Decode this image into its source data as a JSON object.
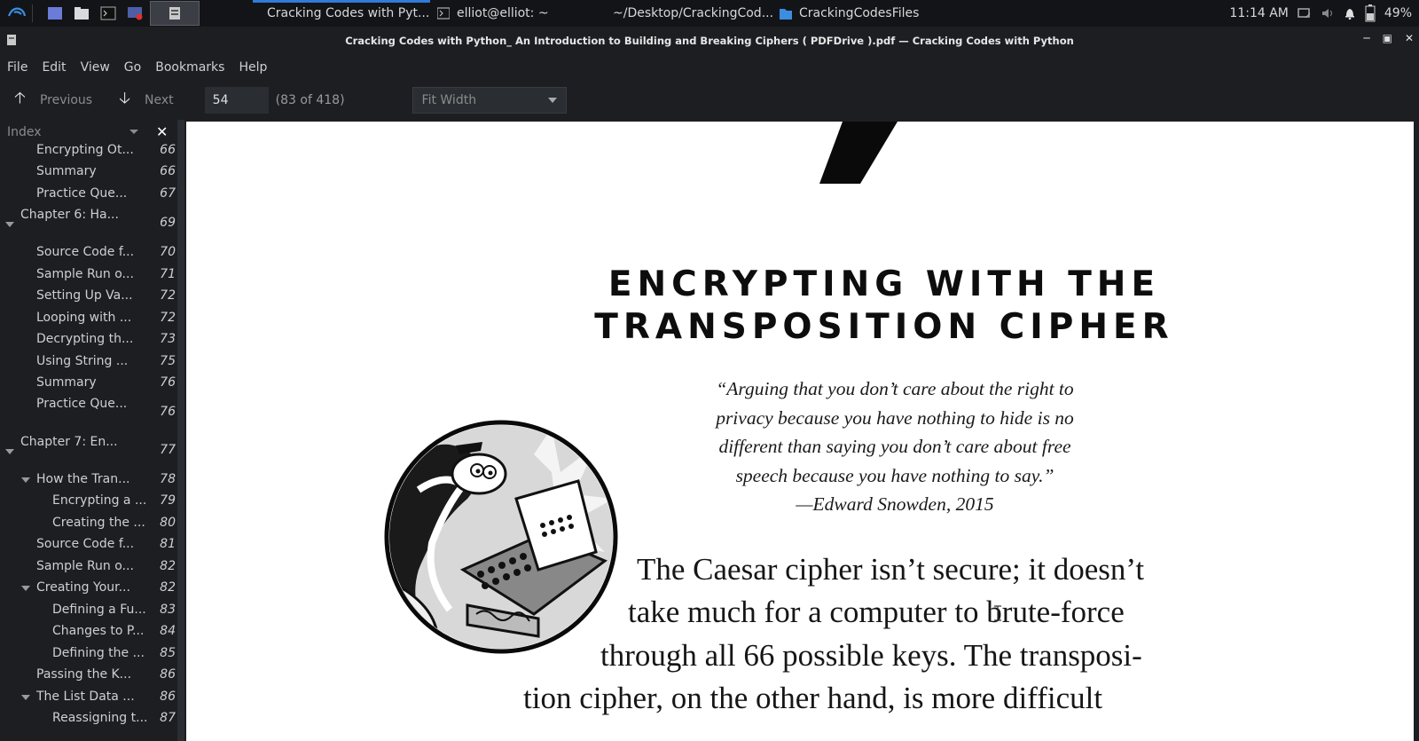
{
  "taskbar": {
    "tasks": [
      {
        "label": "Cracking Codes with Pyt..."
      },
      {
        "label": "elliot@elliot: ~"
      },
      {
        "label": "~/Desktop/CrackingCod..."
      },
      {
        "label": "CrackingCodesFiles"
      }
    ],
    "clock": "11:14 AM",
    "battery": "49%"
  },
  "window": {
    "title": "Cracking Codes with Python_ An Introduction to Building and Breaking Ciphers ( PDFDrive ).pdf — Cracking Codes with Python"
  },
  "menu": [
    "File",
    "Edit",
    "View",
    "Go",
    "Bookmarks",
    "Help"
  ],
  "toolbar": {
    "previous_label": "Previous",
    "next_label": "Next",
    "page_value": "54",
    "page_count": "(83 of 418)",
    "zoom": "Fit Width"
  },
  "sidebar": {
    "header": "Index",
    "items": [
      {
        "label": "Encrypting Ot...",
        "page": "66"
      },
      {
        "label": "Summary",
        "page": "66"
      },
      {
        "label": "Practice Que...",
        "page": "67"
      },
      {
        "label": "Chapter 6: Ha...",
        "page": "69"
      },
      {
        "label": "Source Code f...",
        "page": "70"
      },
      {
        "label": "Sample Run o...",
        "page": "71"
      },
      {
        "label": "Setting Up Va...",
        "page": "72"
      },
      {
        "label": "Looping with ...",
        "page": "72"
      },
      {
        "label": "Decrypting th...",
        "page": "73"
      },
      {
        "label": "Using String ...",
        "page": "75"
      },
      {
        "label": "Summary",
        "page": "76"
      },
      {
        "label": "Practice Que...",
        "page": "76"
      },
      {
        "label": "Chapter 7: En...",
        "page": "77"
      },
      {
        "label": "How the Tran...",
        "page": "78"
      },
      {
        "label": "Encrypting a ...",
        "page": "79"
      },
      {
        "label": "Creating the ...",
        "page": "80"
      },
      {
        "label": "Source Code f...",
        "page": "81"
      },
      {
        "label": "Sample Run o...",
        "page": "82"
      },
      {
        "label": "Creating Your...",
        "page": "82"
      },
      {
        "label": "Defining a Fu...",
        "page": "83"
      },
      {
        "label": "Changes to P...",
        "page": "84"
      },
      {
        "label": "Defining the ...",
        "page": "85"
      },
      {
        "label": "Passing the K...",
        "page": "86"
      },
      {
        "label": "The List Data ...",
        "page": "86"
      },
      {
        "label": "Reassigning t...",
        "page": "87"
      }
    ]
  },
  "document": {
    "chapter_title_line1": "ENCRYPTING WITH THE",
    "chapter_title_line2": "TRANSPOSITION CIPHER",
    "quote_lines": [
      "“Arguing that you don’t care about the right to",
      "privacy because you have nothing to hide is no",
      "different than saying you don’t care about free",
      "speech because you have nothing to say.”",
      "—Edward Snowden, 2015"
    ],
    "body_lines": [
      "The Caesar cipher isn’t secure; it doesn’t",
      "take much for a computer to brute-force",
      "through all 66 possible keys. The transposi-",
      "tion cipher, on the other hand, is more difficult"
    ]
  }
}
